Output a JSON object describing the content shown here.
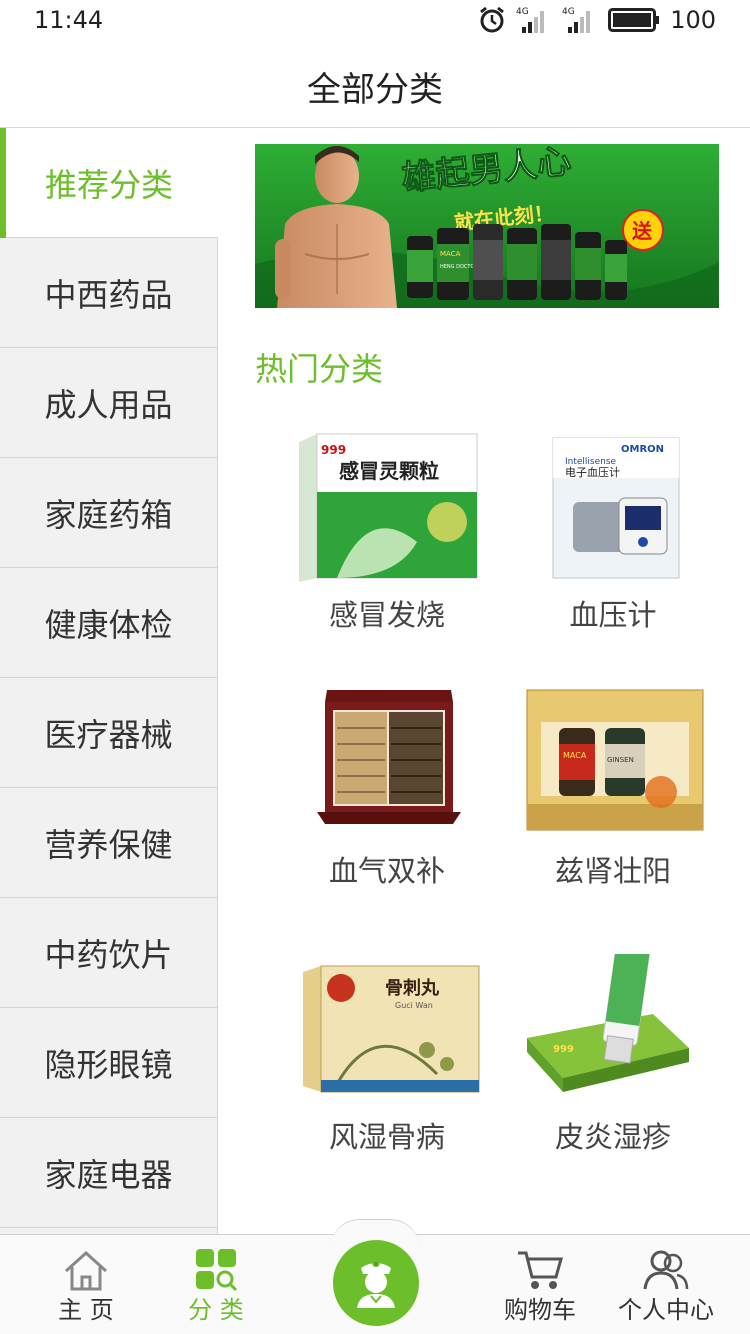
{
  "status_bar": {
    "time": "11:44",
    "signal_1": "4G",
    "signal_2": "4G",
    "battery": "100"
  },
  "header": {
    "title": "全部分类"
  },
  "sidebar": {
    "items": [
      {
        "label": "推荐分类",
        "active": true
      },
      {
        "label": "中西药品"
      },
      {
        "label": "成人用品"
      },
      {
        "label": "家庭药箱"
      },
      {
        "label": "健康体检"
      },
      {
        "label": "医疗器械"
      },
      {
        "label": "营养保健"
      },
      {
        "label": "中药饮片"
      },
      {
        "label": "隐形眼镜"
      },
      {
        "label": "家庭电器"
      }
    ]
  },
  "banner": {
    "headline": "雄起男人心",
    "subline": "就在此刻！",
    "gift_badge": "送",
    "bottle_brand": "MACA",
    "bottle_label": "HENG DOCTOR"
  },
  "hot": {
    "title": "热门分类",
    "items": [
      {
        "label": "感冒发烧",
        "product_brand": "999",
        "product_name": "感冒灵颗粒",
        "icon": "cold-medicine-box"
      },
      {
        "label": "血压计",
        "product_brand": "OMRON",
        "product_name": "电子血压计",
        "product_series": "Intellisense",
        "icon": "blood-pressure-monitor-box"
      },
      {
        "label": "血气双补",
        "icon": "herbal-gift-box"
      },
      {
        "label": "兹肾壮阳",
        "product_brand": "MACA",
        "product_series": "GINSEN",
        "icon": "supplement-gift-box"
      },
      {
        "label": "风湿骨病",
        "product_name": "骨刺丸",
        "product_pinyin": "Guci Wan",
        "icon": "herbal-pill-box"
      },
      {
        "label": "皮炎湿疹",
        "product_brand": "999",
        "icon": "ointment-tube-box"
      }
    ]
  },
  "tabbar": {
    "items": [
      {
        "label": "主 页",
        "icon": "home-icon"
      },
      {
        "label": "分 类",
        "icon": "category-icon",
        "active": true
      },
      {
        "label": "",
        "icon": "pharmacist-icon"
      },
      {
        "label": "购物车",
        "icon": "cart-icon"
      },
      {
        "label": "个人中心",
        "icon": "user-icon"
      }
    ]
  },
  "colors": {
    "accent": "#6cbf2b",
    "sidebar_bg": "#f1f1f1",
    "banner_green": "#2f9a2c"
  }
}
